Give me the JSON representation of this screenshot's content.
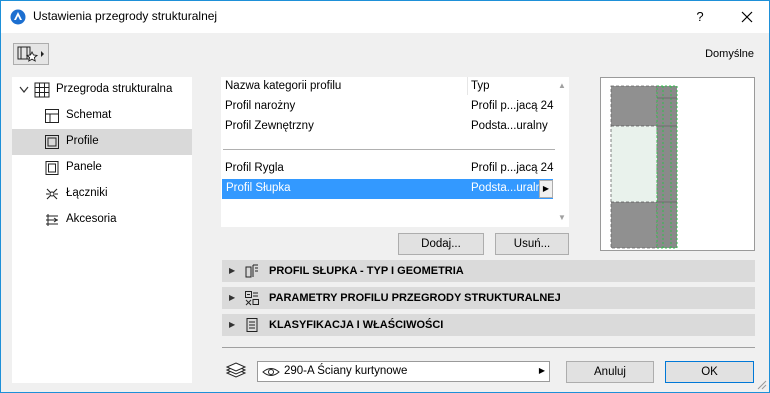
{
  "window": {
    "title": "Ustawienia przegrody strukturalnej",
    "help_label": "?"
  },
  "toolbar": {
    "defaults_label": "Domyślne"
  },
  "tree": {
    "root_label": "Przegroda strukturalna",
    "items": [
      {
        "label": "Schemat",
        "icon": "schema-icon"
      },
      {
        "label": "Profile",
        "icon": "profile-icon",
        "selected": true
      },
      {
        "label": "Panele",
        "icon": "panel-icon"
      },
      {
        "label": "Łączniki",
        "icon": "connector-icon"
      },
      {
        "label": "Akcesoria",
        "icon": "accessory-icon"
      }
    ]
  },
  "profile_table": {
    "header": {
      "name": "Nazwa kategorii profilu",
      "type": "Typ"
    },
    "rows": [
      {
        "name": "Profil narożny",
        "type": "Profil p...jacą 24"
      },
      {
        "name": "Profil Zewnętrzny",
        "type": "Podsta...uralny"
      },
      {
        "name": "Profil Rygla",
        "type": "Profil p...jacą 24"
      },
      {
        "name": "Profil Słupka",
        "type": "Podsta...uralny",
        "selected": true
      }
    ]
  },
  "buttons": {
    "add": "Dodaj...",
    "remove": "Usuń...",
    "cancel": "Anuluj",
    "ok": "OK"
  },
  "sections": [
    {
      "label": "PROFIL SŁUPKA - TYP I GEOMETRIA",
      "icon": "profile-type-icon"
    },
    {
      "label": "PARAMETRY PROFILU PRZEGRODY STRUKTURALNEJ",
      "icon": "parameters-icon"
    },
    {
      "label": "KLASYFIKACJA I WŁAŚCIWOŚCI",
      "icon": "classification-icon"
    }
  ],
  "layer": {
    "value": "290-A Ściany kurtynowe"
  },
  "colors": {
    "accent": "#3399ff",
    "window_border": "#1e90d8",
    "preview_green": "#2fbf4a"
  }
}
